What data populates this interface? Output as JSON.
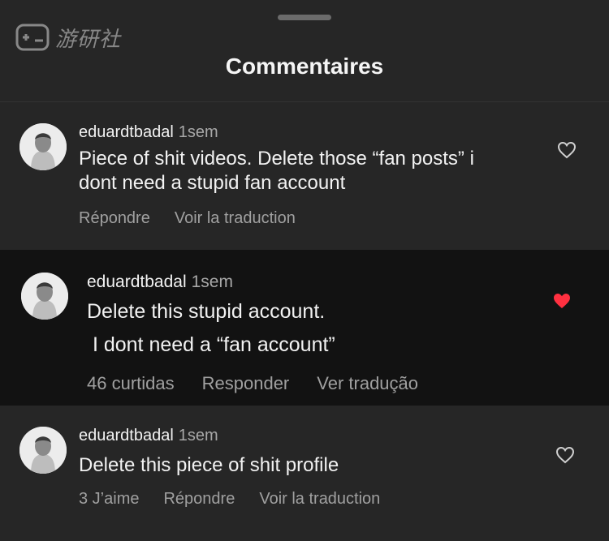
{
  "watermark": {
    "text": "游研社",
    "icon": "gamepad-icon"
  },
  "sheet": {
    "title": "Commentaires"
  },
  "comments": [
    {
      "username": "eduardtbadal",
      "time": "1sem",
      "lines": [
        "Piece of shit videos. Delete those “fan posts” i",
        "dont need a stupid fan account"
      ],
      "actions": [
        "Répondre",
        "Voir la traduction"
      ],
      "liked": false,
      "like_icon": "heart-outline-icon"
    },
    {
      "username": "eduardtbadal",
      "time": "1sem",
      "lines": [
        "Delete this stupid account.",
        " I dont need a “fan account”"
      ],
      "actions": [
        "46 curtidas",
        "Responder",
        "Ver tradução"
      ],
      "liked": true,
      "like_icon": "heart-filled-icon",
      "like_color": "#ff3040"
    },
    {
      "username": "eduardtbadal",
      "time": "1sem",
      "lines": [
        "Delete this piece of shit profile"
      ],
      "actions": [
        "3 J’aime",
        "Répondre",
        "Voir la traduction"
      ],
      "liked": false,
      "like_icon": "heart-outline-icon"
    }
  ],
  "colors": {
    "background": "#262626",
    "highlight_background": "#121212",
    "secondary_text": "#a8a8a8",
    "like_red": "#ff3040"
  }
}
